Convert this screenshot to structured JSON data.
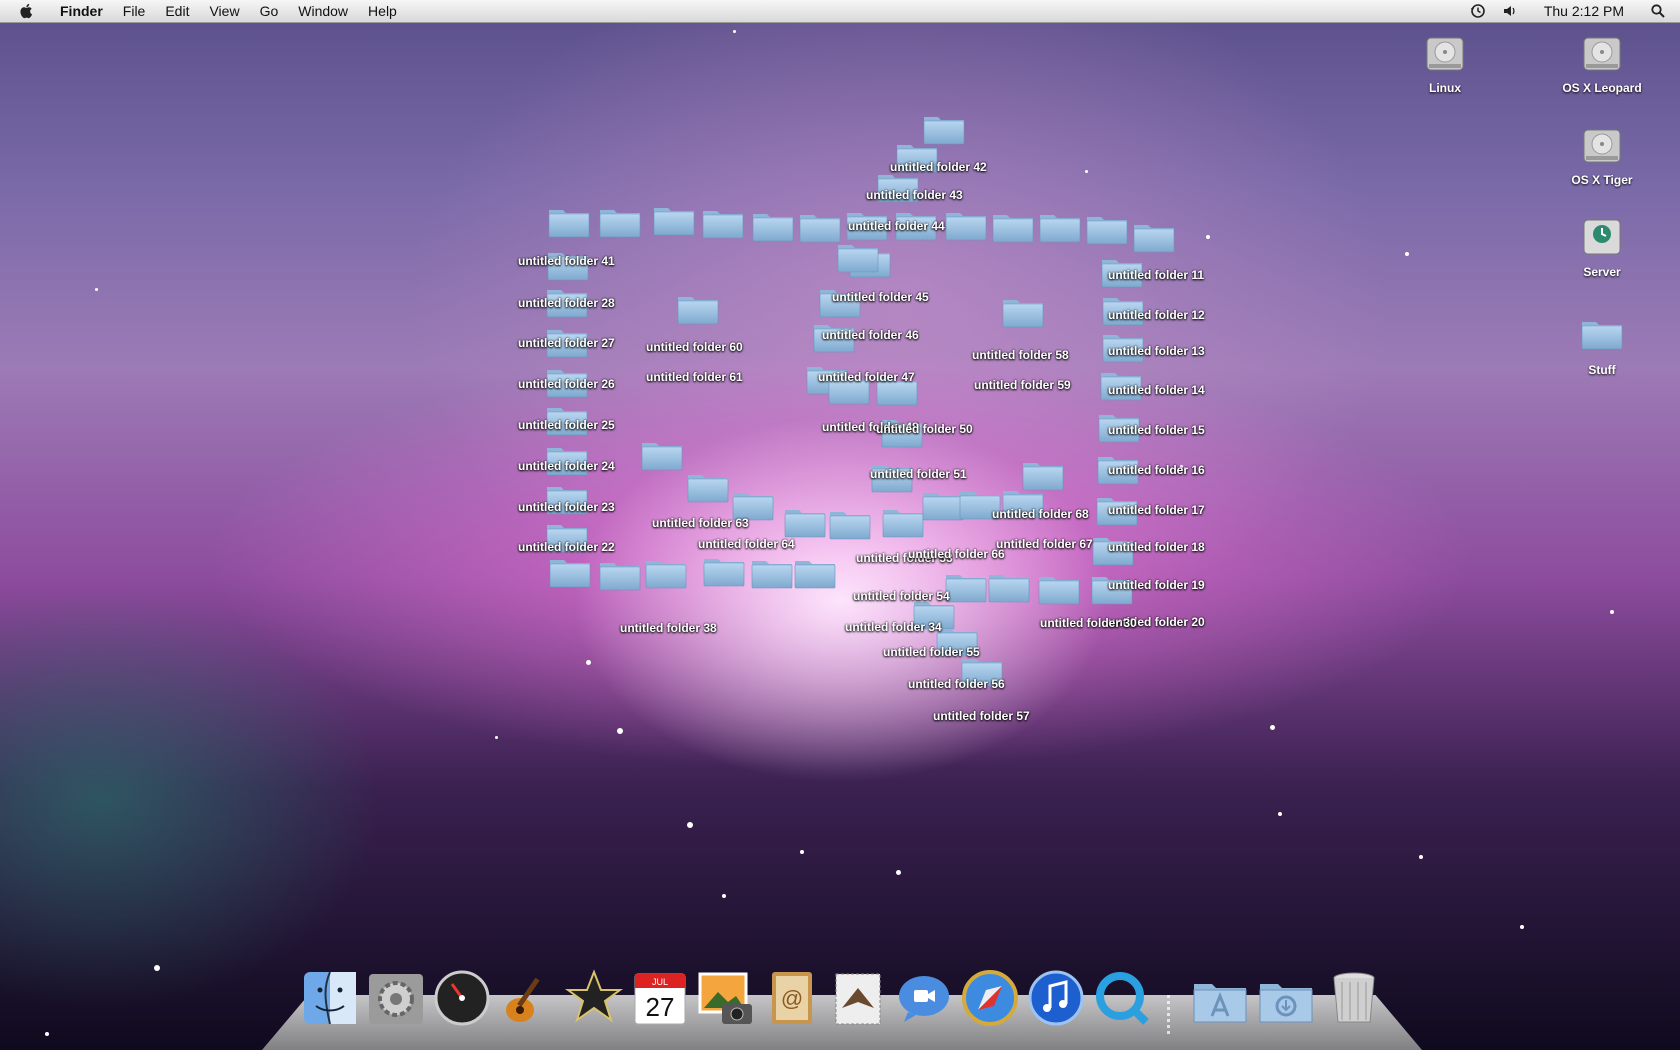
{
  "menubar": {
    "apple_icon": "apple-logo-icon",
    "items": [
      "Finder",
      "File",
      "Edit",
      "View",
      "Go",
      "Window",
      "Help"
    ],
    "clock": "Thu 2:12 PM",
    "status_icons": [
      "time-machine-icon",
      "volume-icon",
      "spotlight-search-icon"
    ]
  },
  "desktop": {
    "drives": [
      {
        "label": "Linux",
        "icon": "hard-drive-icon"
      },
      {
        "label": "OS X Leopard",
        "icon": "hard-drive-icon"
      },
      {
        "label": "OS X Tiger",
        "icon": "hard-drive-icon"
      },
      {
        "label": "Server",
        "icon": "time-machine-drive-icon"
      },
      {
        "label": "Stuff",
        "icon": "folder-icon"
      }
    ],
    "folder_labels": [
      "untitled folder 42",
      "untitled folder 43",
      "untitled folder 44",
      "untitled folder 45",
      "untitled folder 46",
      "untitled folder 47",
      "untitled folder 48",
      "untitled folder 50",
      "untitled folder 51",
      "untitled folder 53",
      "untitled folder 54",
      "untitled folder 55",
      "untitled folder 56",
      "untitled folder 57",
      "untitled folder 58",
      "untitled folder 59",
      "untitled folder 60",
      "untitled folder 61",
      "untitled folder 63",
      "untitled folder 64",
      "untitled folder 66",
      "untitled folder 67",
      "untitled folder 68",
      "untitled folder 11",
      "untitled folder 12",
      "untitled folder 13",
      "untitled folder 14",
      "untitled folder 15",
      "untitled folder 16",
      "untitled folder 17",
      "untitled folder 18",
      "untitled folder 19",
      "untitled folder 20",
      "untitled folder 22",
      "untitled folder 23",
      "untitled folder 24",
      "untitled folder 25",
      "untitled folder 26",
      "untitled folder 27",
      "untitled folder 28",
      "untitled folder 30",
      "untitled folder 34",
      "untitled folder 38",
      "untitled folder 41"
    ]
  },
  "dock": {
    "apps": [
      {
        "name": "Finder",
        "icon": "finder-icon"
      },
      {
        "name": "System Preferences",
        "icon": "system-preferences-icon"
      },
      {
        "name": "Dashboard",
        "icon": "dashboard-icon"
      },
      {
        "name": "GarageBand",
        "icon": "garageband-icon"
      },
      {
        "name": "iMovie",
        "icon": "imovie-icon"
      },
      {
        "name": "iCal",
        "icon": "ical-icon",
        "date_month": "JUL",
        "date_day": "27"
      },
      {
        "name": "iPhoto",
        "icon": "iphoto-icon"
      },
      {
        "name": "Address Book",
        "icon": "address-book-icon"
      },
      {
        "name": "Mail",
        "icon": "mail-icon"
      },
      {
        "name": "iChat",
        "icon": "ichat-icon"
      },
      {
        "name": "Safari",
        "icon": "safari-icon"
      },
      {
        "name": "iTunes",
        "icon": "itunes-icon"
      },
      {
        "name": "QuickTime Player",
        "icon": "quicktime-icon"
      },
      {
        "name": "Applications",
        "icon": "applications-folder-icon"
      },
      {
        "name": "Downloads",
        "icon": "downloads-folder-icon"
      },
      {
        "name": "Trash",
        "icon": "trash-icon"
      }
    ]
  }
}
